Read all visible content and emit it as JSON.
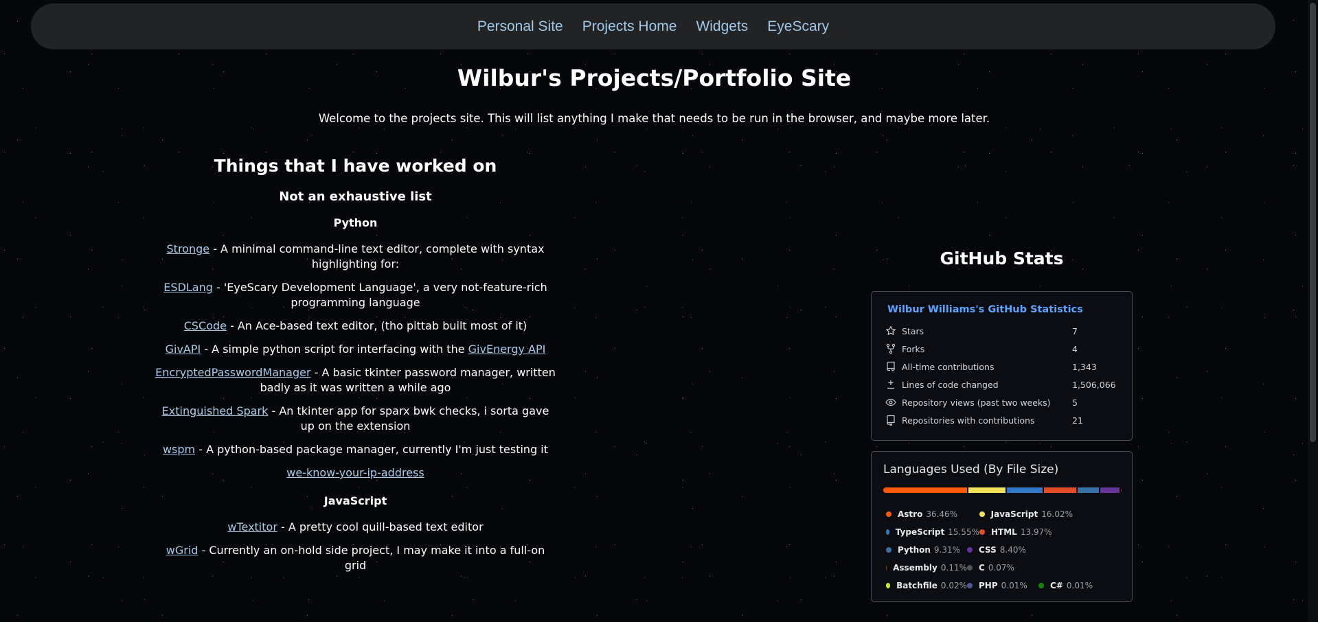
{
  "nav": [
    {
      "label": "Personal Site"
    },
    {
      "label": "Projects Home"
    },
    {
      "label": "Widgets"
    },
    {
      "label": "EyeScary"
    }
  ],
  "page_title": "Wilbur's Projects/Portfolio Site",
  "welcome": "Welcome to the projects site. This will list anything I make that needs to be run in the browser, and maybe more later.",
  "projects": {
    "heading": "Things that I have worked on",
    "subheading": "Not an exhaustive list",
    "python_heading": "Python",
    "python": [
      {
        "name": "Stronge",
        "desc": " - A minimal command-line text editor, complete with syntax highlighting for:"
      },
      {
        "name": "ESDLang",
        "desc": " - 'EyeScary Development Language', a very not-feature-rich programming language"
      },
      {
        "name": "CSCode",
        "desc": " - An Ace-based text editor, (tho pittab built most of it)"
      },
      {
        "name": "GivAPI",
        "desc": " - A simple python script for interfacing with the ",
        "link2": "GivEnergy API"
      },
      {
        "name": "EncryptedPasswordManager",
        "desc": " - A basic tkinter password manager, written badly as it was written a while ago"
      },
      {
        "name": "Extinguished Spark",
        "desc": " - An tkinter app for sparx bwk checks, i sorta gave up on the extension"
      },
      {
        "name": "wspm",
        "desc": " - A python-based package manager, currently I'm just testing it"
      },
      {
        "name": "we-know-your-ip-address",
        "desc": ""
      }
    ],
    "js_heading": "JavaScript",
    "javascript": [
      {
        "name": "wTextitor",
        "desc": " - A pretty cool quill-based text editor"
      },
      {
        "name": "wGrid",
        "desc": " - Currently an on-hold side project, I may make it into a full-on grid"
      }
    ]
  },
  "github": {
    "heading": "GitHub Stats",
    "stats_title": "Wilbur Williams's GitHub Statistics",
    "stats": [
      {
        "icon": "star-icon",
        "label": "Stars",
        "value": "7"
      },
      {
        "icon": "fork-icon",
        "label": "Forks",
        "value": "4"
      },
      {
        "icon": "contributions-icon",
        "label": "All-time contributions",
        "value": "1,343"
      },
      {
        "icon": "diff-icon",
        "label": "Lines of code changed",
        "value": "1,506,066"
      },
      {
        "icon": "eye-icon",
        "label": "Repository views (past two weeks)",
        "value": "5"
      },
      {
        "icon": "repo-icon",
        "label": "Repositories with contributions",
        "value": "21"
      }
    ],
    "languages_title": "Languages Used (By File Size)",
    "languages": [
      {
        "name": "Astro",
        "pct": "36.46%",
        "share": 36.46,
        "color": "#ff5a03"
      },
      {
        "name": "JavaScript",
        "pct": "16.02%",
        "share": 16.02,
        "color": "#f1e05a"
      },
      {
        "name": "TypeScript",
        "pct": "15.55%",
        "share": 15.55,
        "color": "#3178c6"
      },
      {
        "name": "HTML",
        "pct": "13.97%",
        "share": 13.97,
        "color": "#e34c26"
      },
      {
        "name": "Python",
        "pct": "9.31%",
        "share": 9.31,
        "color": "#3572a5"
      },
      {
        "name": "CSS",
        "pct": "8.40%",
        "share": 8.4,
        "color": "#663399"
      },
      {
        "name": "Assembly",
        "pct": "0.11%",
        "share": 0.11,
        "color": "#6e4c13"
      },
      {
        "name": "C",
        "pct": "0.07%",
        "share": 0.07,
        "color": "#555555"
      },
      {
        "name": "Batchfile",
        "pct": "0.02%",
        "share": 0.02,
        "color": "#c1f12e"
      },
      {
        "name": "PHP",
        "pct": "0.01%",
        "share": 0.01,
        "color": "#4f5d95"
      },
      {
        "name": "C#",
        "pct": "0.01%",
        "share": 0.01,
        "color": "#178600"
      }
    ]
  }
}
